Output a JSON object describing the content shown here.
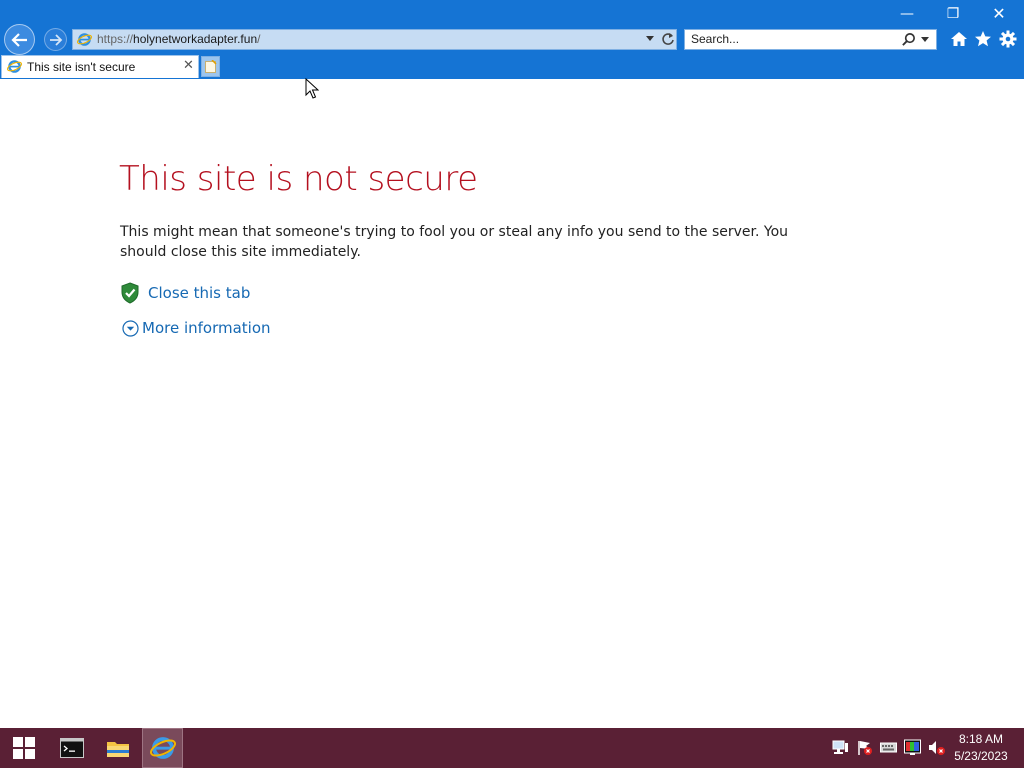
{
  "window": {
    "minimize_glyph": "—",
    "restore_glyph": "❐",
    "close_glyph": "✕"
  },
  "address_bar": {
    "protocol": "https://",
    "domain": "holynetworkadapter.fun",
    "path": "/"
  },
  "search": {
    "placeholder": "Search..."
  },
  "tab": {
    "title": "This site isn't secure",
    "close_glyph": "✕"
  },
  "page": {
    "heading": "This site is not secure",
    "description": "This might mean that someone's trying to fool you or steal any info you send to the server. You should close this site immediately.",
    "close_link": "Close this tab",
    "more_link": "More information"
  },
  "taskbar": {
    "time": "8:18 AM",
    "date": "5/23/2023"
  },
  "colors": {
    "chrome_blue": "#1574d4",
    "heading_red": "#b4101f",
    "link_blue": "#1669b3",
    "taskbar": "#5a2035"
  }
}
